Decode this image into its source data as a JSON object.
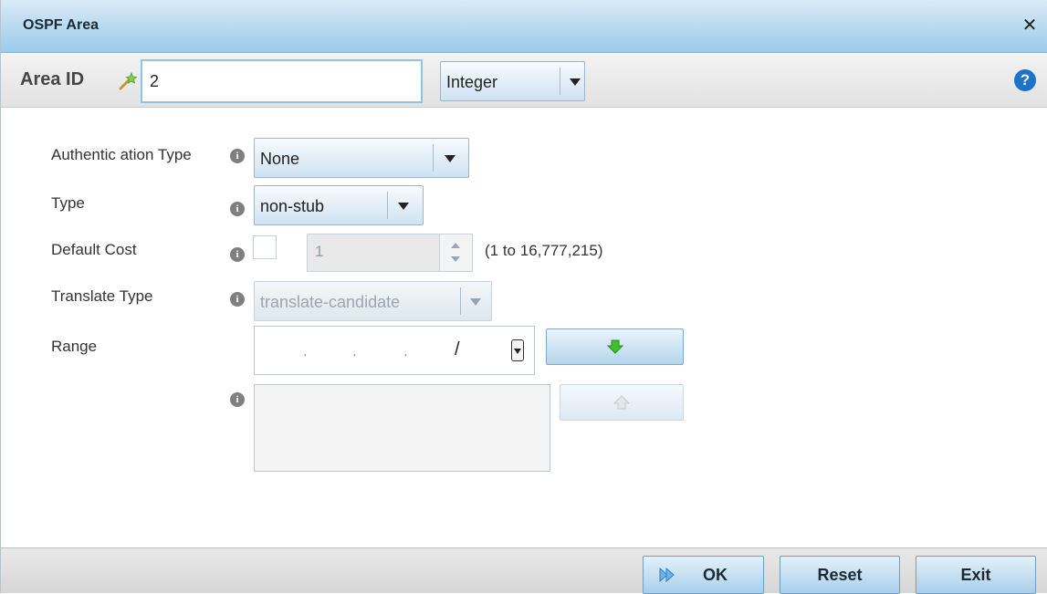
{
  "dialog": {
    "title": "OSPF Area"
  },
  "area_id": {
    "label": "Area ID",
    "value": "2",
    "type_select": "Integer"
  },
  "form": {
    "auth_type": {
      "label": "Authentic ation Type",
      "value": "None"
    },
    "type": {
      "label": "Type",
      "value": "non-stub"
    },
    "default_cost": {
      "label": "Default Cost",
      "value": "1",
      "hint": "(1 to 16,777,215)",
      "checked": false
    },
    "translate_type": {
      "label": "Translate Type",
      "value": "translate-candidate"
    },
    "range": {
      "label": "Range",
      "slash": "/"
    }
  },
  "footer": {
    "ok_label": "OK",
    "reset_label": "Reset",
    "exit_label": "Exit"
  },
  "icons": {
    "close": "close-icon",
    "help": "help-icon",
    "info": "info-icon",
    "wand": "wand-icon",
    "add": "green-arrow-down-icon",
    "remove": "arrow-up-icon",
    "ok": "ok-icon"
  },
  "colors": {
    "accent": "#9ccbea",
    "help": "#1e72c7",
    "add_arrow": "#3fbf2a"
  }
}
